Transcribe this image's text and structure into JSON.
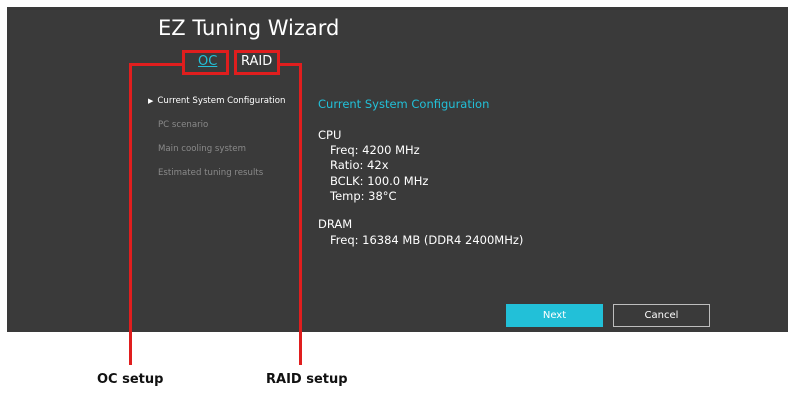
{
  "window": {
    "title": "EZ Tuning Wizard"
  },
  "tabs": [
    {
      "label": "OC",
      "active": true
    },
    {
      "label": "RAID",
      "active": false
    }
  ],
  "steps": [
    {
      "label": "Current System Configuration",
      "active": true
    },
    {
      "label": "PC scenario",
      "active": false
    },
    {
      "label": "Main cooling system",
      "active": false
    },
    {
      "label": "Estimated tuning results",
      "active": false
    }
  ],
  "content": {
    "title": "Current System Configuration",
    "cpu": {
      "heading": "CPU",
      "freq": "Freq: 4200 MHz",
      "ratio": "Ratio: 42x",
      "bclk": "BCLK: 100.0 MHz",
      "temp": "Temp: 38°C"
    },
    "dram": {
      "heading": "DRAM",
      "freq": "Freq: 16384 MB (DDR4 2400MHz)"
    }
  },
  "buttons": {
    "next": "Next",
    "cancel": "Cancel"
  },
  "callouts": {
    "oc": "OC setup",
    "raid": "RAID setup"
  },
  "colors": {
    "background": "#3a3a3a",
    "accent": "#22c0d8",
    "highlight": "#e01e1e",
    "inactive_text": "#8a8a8a"
  }
}
